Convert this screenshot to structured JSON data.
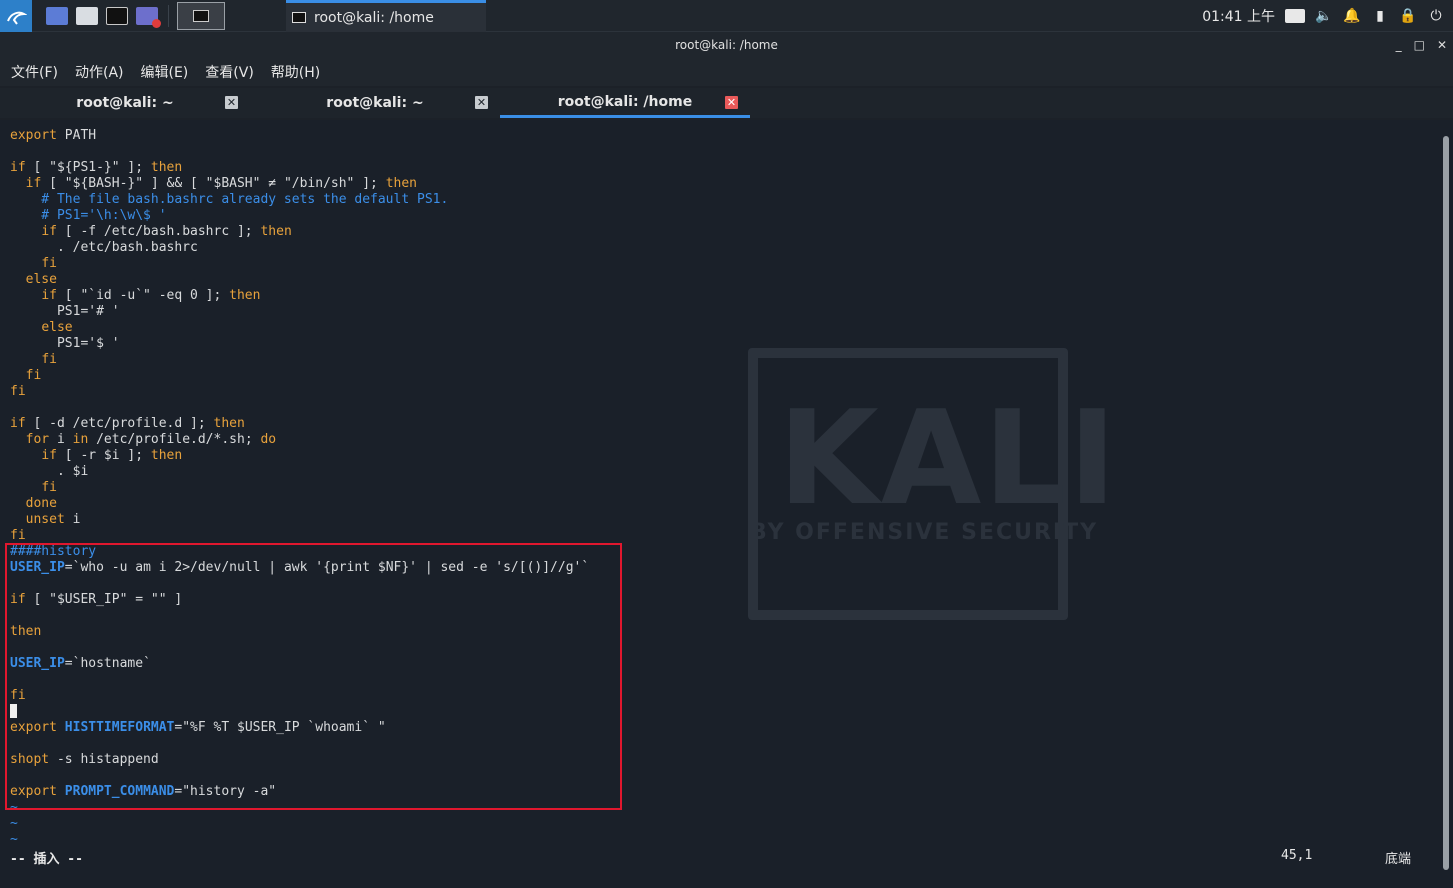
{
  "panel": {
    "task_title": "root@kali: /home",
    "clock": "01:41 上午"
  },
  "window": {
    "title": "root@kali: /home",
    "controls": [
      "_",
      "□",
      "✕"
    ]
  },
  "menubar": {
    "items": [
      "文件(F)",
      "动作(A)",
      "编辑(E)",
      "查看(V)",
      "帮助(H)"
    ]
  },
  "tabs": [
    {
      "label": "root@kali: ~",
      "active": false
    },
    {
      "label": "root@kali: ~",
      "active": false
    },
    {
      "label": "root@kali: /home",
      "active": true
    }
  ],
  "editor": {
    "lines": [
      "export PATH",
      "",
      "if [ \"${PS1-}\" ]; then",
      "  if [ \"${BASH-}\" ] && [ \"$BASH\" ≠ \"/bin/sh\" ]; then",
      "    # The file bash.bashrc already sets the default PS1.",
      "    # PS1='\\h:\\w\\$ '",
      "    if [ -f /etc/bash.bashrc ]; then",
      "      . /etc/bash.bashrc",
      "    fi",
      "  else",
      "    if [ \"`id -u`\" -eq 0 ]; then",
      "      PS1='# '",
      "    else",
      "      PS1='$ '",
      "    fi",
      "  fi",
      "fi",
      "",
      "if [ -d /etc/profile.d ]; then",
      "  for i in /etc/profile.d/*.sh; do",
      "    if [ -r $i ]; then",
      "      . $i",
      "    fi",
      "  done",
      "  unset i",
      "fi",
      "####history",
      "USER_IP=`who -u am i 2>/dev/null | awk '{print $NF}' | sed -e 's/[()]//g'`",
      "",
      "if [ \"$USER_IP\" = \"\" ]",
      "",
      "then",
      "",
      "USER_IP=`hostname`",
      "",
      "fi",
      "",
      "export HISTTIMEFORMAT=\"%F %T $USER_IP `whoami` \"",
      "",
      "shopt -s histappend",
      "",
      "export PROMPT_COMMAND=\"history -a\"",
      "~",
      "~",
      "~"
    ],
    "mode": "-- 插入 --",
    "position": "45,1",
    "scroll_position": "底端"
  },
  "background": {
    "logo_text": "KALI",
    "tagline": "BY OFFENSIVE SECURITY"
  },
  "colors": {
    "accent": "#3a8ee6",
    "highlight_box": "#e0172e",
    "keyword": "#e8a23c",
    "comment": "#3b8ee8"
  }
}
